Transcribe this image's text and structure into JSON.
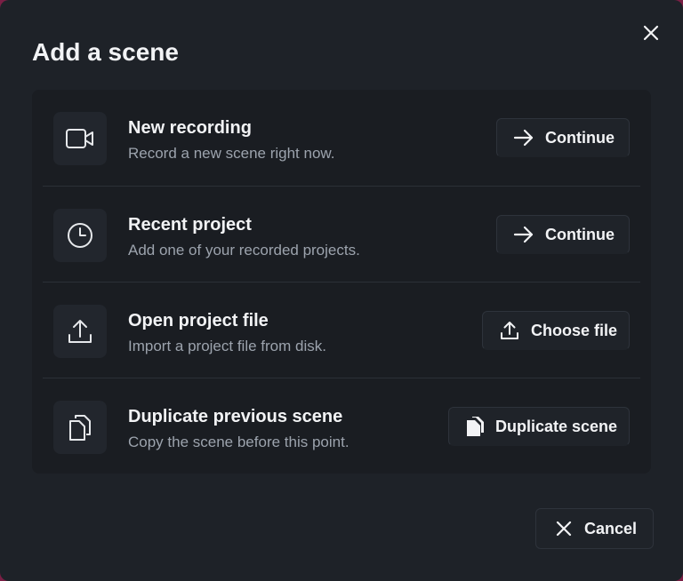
{
  "dialog": {
    "title": "Add a scene",
    "close_icon": "close-icon",
    "cancel_label": "Cancel",
    "cancel_icon": "close-icon"
  },
  "options": [
    {
      "title": "New recording",
      "description": "Record a new scene right now.",
      "icon": "video-camera-icon",
      "button_label": "Continue",
      "button_icon": "arrow-right-icon"
    },
    {
      "title": "Recent project",
      "description": "Add one of your recorded projects.",
      "icon": "clock-icon",
      "button_label": "Continue",
      "button_icon": "arrow-right-icon"
    },
    {
      "title": "Open project file",
      "description": "Import a project file from disk.",
      "icon": "upload-icon",
      "button_label": "Choose file",
      "button_icon": "upload-icon"
    },
    {
      "title": "Duplicate previous scene",
      "description": "Copy the scene before this point.",
      "icon": "copy-icon",
      "button_label": "Duplicate scene",
      "button_icon": "copy-filled-icon"
    }
  ],
  "colors": {
    "dialog_bg": "#1e2228",
    "panel_bg": "#1a1d22",
    "backdrop": "#7a1f45",
    "text_primary": "#f2f3f5",
    "text_secondary": "#9ca3ad"
  }
}
